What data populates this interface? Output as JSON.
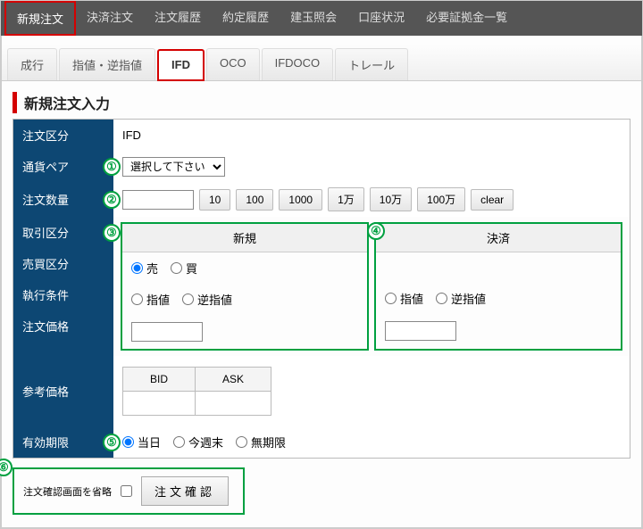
{
  "topnav": {
    "items": [
      "新規注文",
      "決済注文",
      "注文履歴",
      "約定履歴",
      "建玉照会",
      "口座状況",
      "必要証拠金一覧"
    ]
  },
  "tabs": {
    "items": [
      "成行",
      "指値・逆指値",
      "IFD",
      "OCO",
      "IFDOCO",
      "トレール"
    ]
  },
  "title": "新規注文入力",
  "form": {
    "order_type": {
      "label": "注文区分",
      "value": "IFD"
    },
    "pair": {
      "label": "通貨ペア",
      "placeholder": "選択して下さい"
    },
    "qty": {
      "label": "注文数量",
      "buttons": [
        "10",
        "100",
        "1000",
        "1万",
        "10万",
        "100万",
        "clear"
      ]
    },
    "trade_type": {
      "label": "取引区分",
      "col1": "新規",
      "col2": "決済"
    },
    "buysell": {
      "label": "売買区分",
      "sell": "売",
      "buy": "買"
    },
    "exec": {
      "label": "執行条件",
      "limit": "指値",
      "stop": "逆指値"
    },
    "price": {
      "label": "注文価格"
    },
    "ref": {
      "label": "参考価格",
      "bid": "BID",
      "ask": "ASK"
    },
    "expiry": {
      "label": "有効期限",
      "today": "当日",
      "weekend": "今週末",
      "none": "無期限"
    }
  },
  "bottom": {
    "skip_label": "注文確認画面を省略",
    "confirm": "注文確認"
  },
  "nums": {
    "n1": "①",
    "n2": "②",
    "n3": "③",
    "n4": "④",
    "n5": "⑤",
    "n6": "⑥"
  }
}
